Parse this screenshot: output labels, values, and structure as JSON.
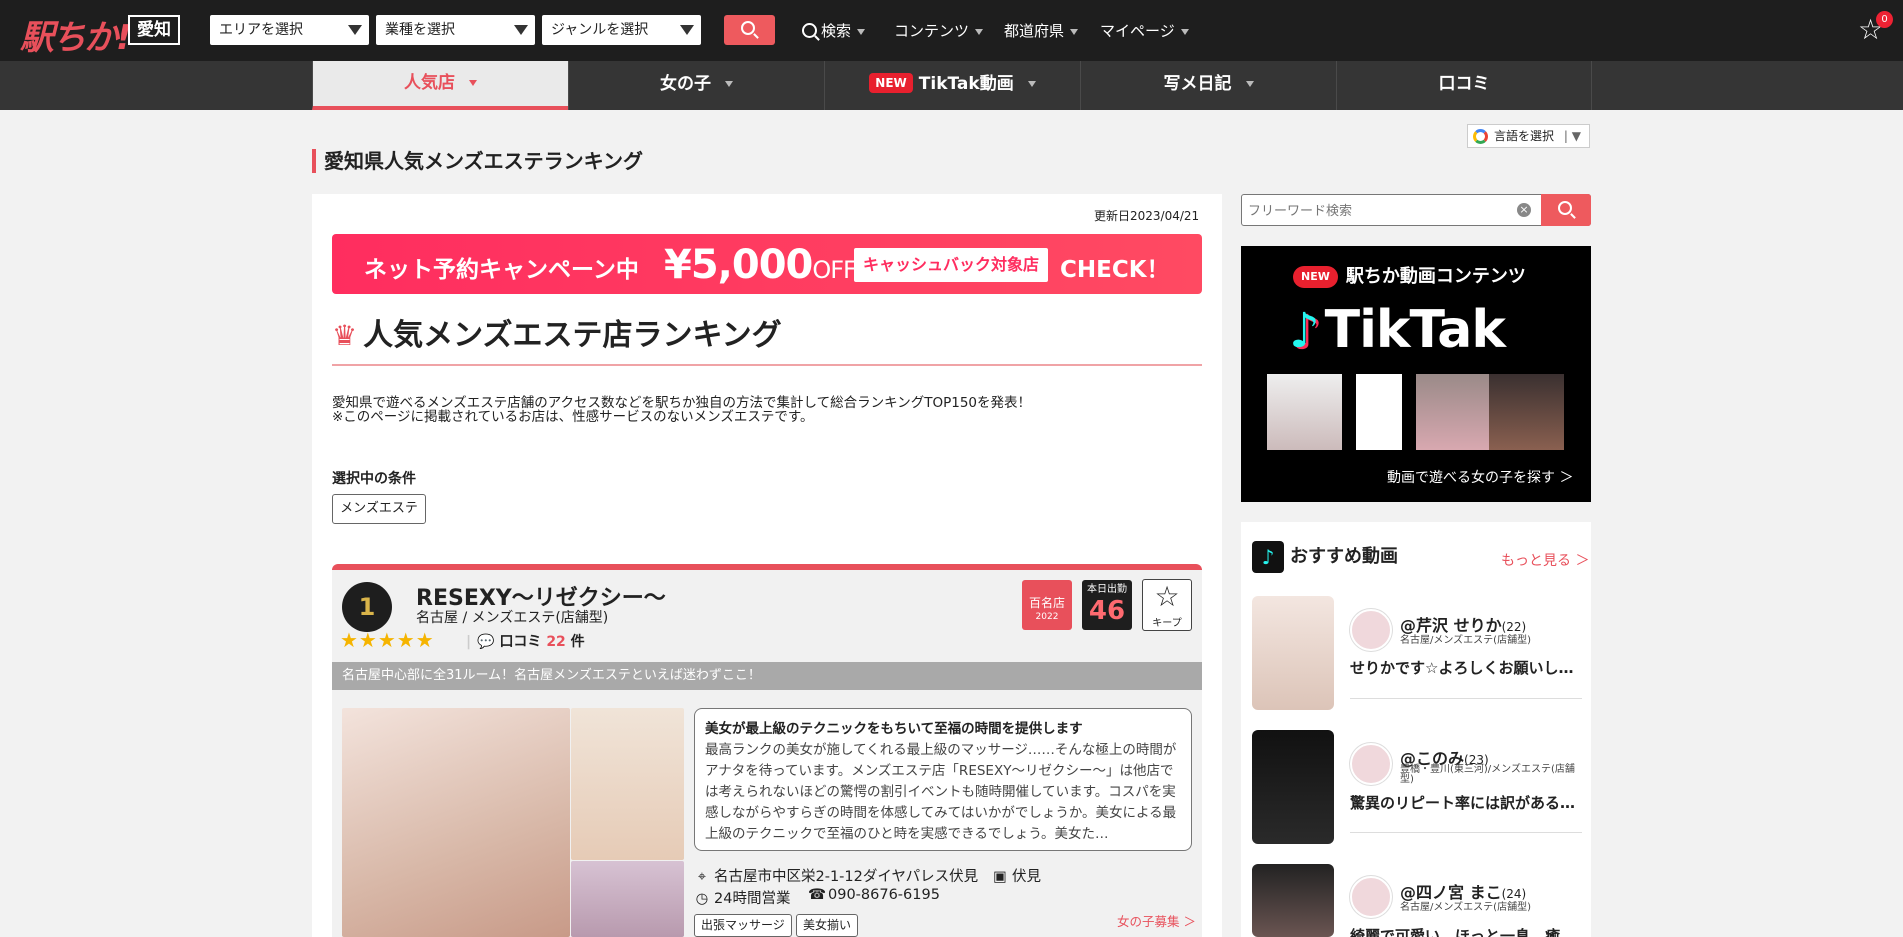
{
  "header": {
    "logo": "駅ちか!",
    "prefecture": "愛知",
    "selects": [
      "エリアを選択",
      "業種を選択",
      "ジャンルを選択"
    ],
    "nav": [
      "検索",
      "コンテンツ",
      "都道府県",
      "マイページ"
    ],
    "notification_count": "0"
  },
  "subnav": {
    "tabs": [
      "人気店",
      "女の子",
      "TikTak動画",
      "写メ日記",
      "口コミ"
    ],
    "new_label": "NEW"
  },
  "language_select": "言語を選択",
  "page_title": "愛知県人気メンズエステランキング",
  "main": {
    "updated": "更新日2023/04/21",
    "banner": {
      "campaign": "ネット予約キャンペーン中",
      "amount": "¥5,000",
      "off": "OFF",
      "cashback": "キャッシュバック対象店",
      "check": "CHECK！"
    },
    "ranking_title": "人気メンズエステ店ランキング",
    "description_1": "愛知県で遊べるメンズエステ店舗のアクセス数などを駅ちか独自の方法で集計して総合ランキングTOP150を発表！",
    "description_2": "※このページに掲載されているお店は、性感サービスのないメンズエステです。",
    "conditions_label": "選択中の条件",
    "condition_tag": "メンズエステ",
    "shop": {
      "rank": "1",
      "name": "RESEXY～リゼクシー～",
      "category": "名古屋 / メンズエステ(店舗型)",
      "stars": "★★★★★",
      "review_label": "口コミ",
      "review_count": "22",
      "review_unit": "件",
      "badge_hyakumeiten": "百名店",
      "badge_year": "2022",
      "badge_work_label": "本日出勤",
      "badge_work_count": "46",
      "keep_label": "キープ",
      "catchcopy": "名古屋中心部に全31ルーム！名古屋メンズエステといえば迷わずここ！",
      "desc_heading": "美女が最上級のテクニックをもちいて至福の時間を提供します",
      "desc_body": "最高ランクの美女が施してくれる最上級のマッサージ……そんな極上の時間がアナタを待っています。メンズエステ店「RESEXY～リゼクシー～」は他店では考えられないほどの驚愕の割引イベントも随時開催しています。コスパを実感しながらやすらぎの時間を体感してみてはいかがでしょうか。美女による最上級のテクニックで至福のひと時を実感できるでしょう。美女た…",
      "address": "名古屋市中区栄2-1-12ダイヤパレス伏見",
      "station": "伏見",
      "hours": "24時間営業",
      "phone": "090-8676-6195",
      "tags": [
        "出張マッサージ",
        "美女揃い"
      ],
      "recruit": "女の子募集 ＞"
    }
  },
  "sidebar": {
    "search_placeholder": "フリーワード検索",
    "tiktok": {
      "new": "NEW",
      "heading": "駅ちか動画コンテンツ",
      "logo": "TikTak",
      "more": "動画で遊べる女の子を探す ＞"
    },
    "recommended": {
      "title": "おすすめ動画",
      "more": "もっと見る ＞",
      "items": [
        {
          "name": "@芹沢 せりか",
          "age": "(22)",
          "category": "名古屋/メンズエステ(店舗型)",
          "text": "せりかです☆よろしくお願いします"
        },
        {
          "name": "@このみ",
          "age": "(23)",
          "category": "豊橋・豊川(東三河)/メンズエステ(店舗型)",
          "text": "驚異のリピート率には訳がある…"
        },
        {
          "name": "@四ノ宮 まこ",
          "age": "(24)",
          "category": "名古屋/メンズエステ(店舗型)",
          "text": "綺麗で可愛い、ほっと一息、癒し…"
        }
      ]
    }
  },
  "colors": {
    "accent": "#e8505b",
    "topbar": "#1e1e1e",
    "subnav": "#353535"
  }
}
